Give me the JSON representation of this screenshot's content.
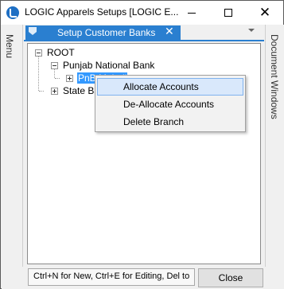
{
  "window": {
    "title": "LOGIC Apparels Setups  [LOGIC E...",
    "close_glyph": "✕"
  },
  "side_panes": {
    "left_label": "Menu",
    "right_label": "Document Windows"
  },
  "tab": {
    "label": "Setup Customer Banks",
    "close_glyph": "✕"
  },
  "tree": {
    "root": "ROOT",
    "bank1": "Punjab National Bank",
    "bank1_child": "PnB Mohali",
    "bank2": "State Ba"
  },
  "context_menu": {
    "items": [
      "Allocate Accounts",
      "De-Allocate Accounts",
      "Delete Branch"
    ]
  },
  "statusbar": {
    "hint": "Ctrl+N for New, Ctrl+E for Editing, Del to",
    "close_label": "Close"
  },
  "colors": {
    "accent": "#2a7fd0",
    "selection": "#3399ff",
    "menu_hover": "#d9e8fb"
  }
}
